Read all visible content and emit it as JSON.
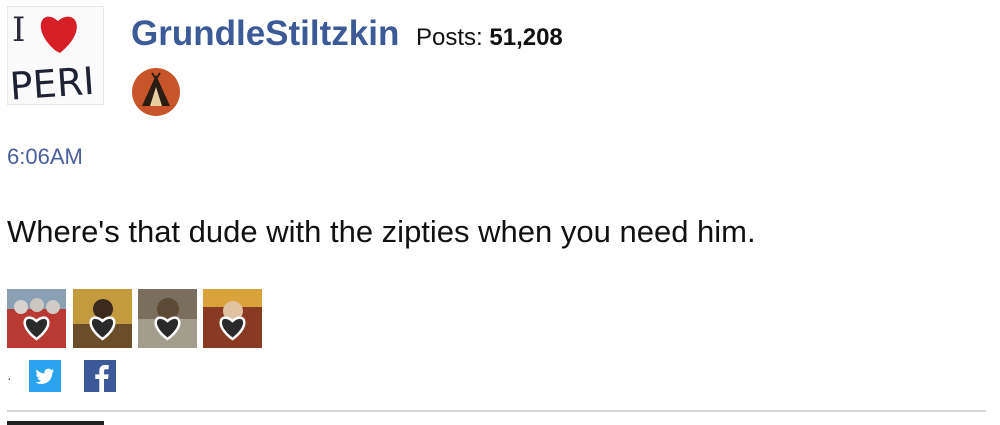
{
  "post": {
    "username": "GrundleStiltzkin",
    "posts_label": "Posts:",
    "posts_count": "51,208",
    "timestamp": "6:06AM",
    "body": "Where's that dude with the zipties when you need him.",
    "separator": "·"
  },
  "avatar": {
    "text_top": "I",
    "text_bottom": "PERI",
    "heart_color": "#d61f26"
  },
  "rank_badge": {
    "icon": "teepee-rank-badge-icon",
    "color": "#c8552a"
  },
  "reactions": [
    {
      "icon": "heart-reaction-icon"
    },
    {
      "icon": "heart-reaction-icon"
    },
    {
      "icon": "heart-reaction-icon"
    },
    {
      "icon": "heart-reaction-icon"
    }
  ],
  "share": {
    "twitter_icon": "twitter-icon",
    "twitter_color": "#2aa3ef",
    "facebook_icon": "facebook-icon",
    "facebook_color": "#3b5998"
  },
  "colors": {
    "username": "#3d5a98",
    "timestamp": "#4a5f9b",
    "divider": "#d6d6d6"
  }
}
